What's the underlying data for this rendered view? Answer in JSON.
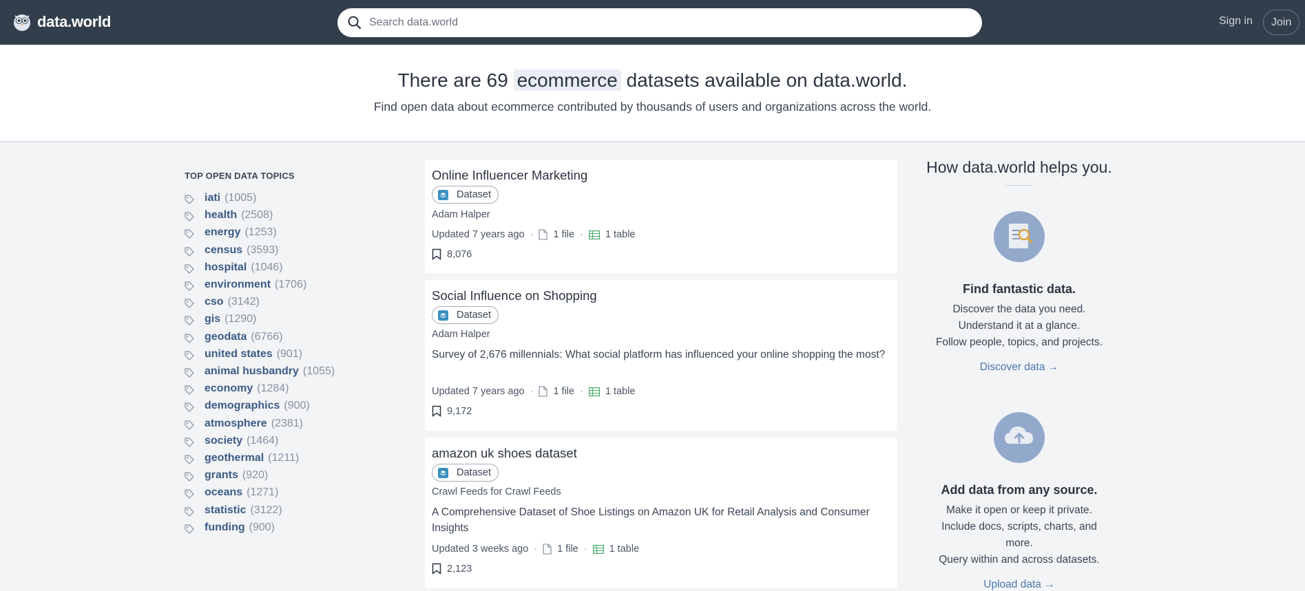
{
  "nav": {
    "logo_text": "data.world",
    "search_placeholder": "Search data.world",
    "signin_label": "Sign in",
    "join_label": "Join"
  },
  "hero": {
    "prefix": "There are 69",
    "keyword": "ecommerce",
    "suffix": "datasets available on data.world.",
    "subtitle": "Find open data about ecommerce contributed by thousands of users and organizations across the world."
  },
  "topics": {
    "heading": "TOP OPEN DATA TOPICS",
    "items": [
      {
        "name": "iati",
        "count": "(1005)"
      },
      {
        "name": "health",
        "count": "(2508)"
      },
      {
        "name": "energy",
        "count": "(1253)"
      },
      {
        "name": "census",
        "count": "(3593)"
      },
      {
        "name": "hospital",
        "count": "(1046)"
      },
      {
        "name": "environment",
        "count": "(1706)"
      },
      {
        "name": "cso",
        "count": "(3142)"
      },
      {
        "name": "gis",
        "count": "(1290)"
      },
      {
        "name": "geodata",
        "count": "(6766)"
      },
      {
        "name": "united states",
        "count": "(901)"
      },
      {
        "name": "animal husbandry",
        "count": "(1055)"
      },
      {
        "name": "economy",
        "count": "(1284)"
      },
      {
        "name": "demographics",
        "count": "(900)"
      },
      {
        "name": "atmosphere",
        "count": "(2381)"
      },
      {
        "name": "society",
        "count": "(1464)"
      },
      {
        "name": "geothermal",
        "count": "(1211)"
      },
      {
        "name": "grants",
        "count": "(920)"
      },
      {
        "name": "oceans",
        "count": "(1271)"
      },
      {
        "name": "statistic",
        "count": "(3122)"
      },
      {
        "name": "funding",
        "count": "(900)"
      }
    ]
  },
  "datasets": [
    {
      "title": "Online Influencer Marketing",
      "badge": "Dataset",
      "owner": "Adam Halper",
      "description": "",
      "updated": "Updated 7 years ago",
      "files": "1 file",
      "tables": "1 table",
      "bookmarks": "8,076"
    },
    {
      "title": "Social Influence on Shopping",
      "badge": "Dataset",
      "owner": "Adam Halper",
      "description": "Survey of 2,676 millennials: What social platform has influenced your online shopping the most?",
      "updated": "Updated 7 years ago",
      "files": "1 file",
      "tables": "1 table",
      "bookmarks": "9,172"
    },
    {
      "title": "amazon uk shoes dataset",
      "badge": "Dataset",
      "owner": "Crawl Feeds for Crawl Feeds",
      "description": "A Comprehensive Dataset of Shoe Listings on Amazon UK for Retail Analysis and Consumer Insights",
      "updated": "Updated 3 weeks ago",
      "files": "1 file",
      "tables": "1 table",
      "bookmarks": "2,123"
    }
  ],
  "helper": {
    "heading": "How data.world helps you.",
    "features": [
      {
        "title": "Find fantastic data.",
        "lines": [
          "Discover the data you need.",
          "Understand it at a glance.",
          "Follow people, topics, and projects."
        ],
        "link": "Discover data →"
      },
      {
        "title": "Add data from any source.",
        "lines": [
          "Make it open or keep it private.",
          "Include docs, scripts, charts, and",
          "more.",
          "Query within and across datasets."
        ],
        "link": "Upload data →"
      }
    ]
  },
  "colors": {
    "nav_bg": "#333e4c",
    "link": "#3b5b85",
    "accent_circle": "#93a9cc",
    "page_bg": "#f3f4f6"
  }
}
